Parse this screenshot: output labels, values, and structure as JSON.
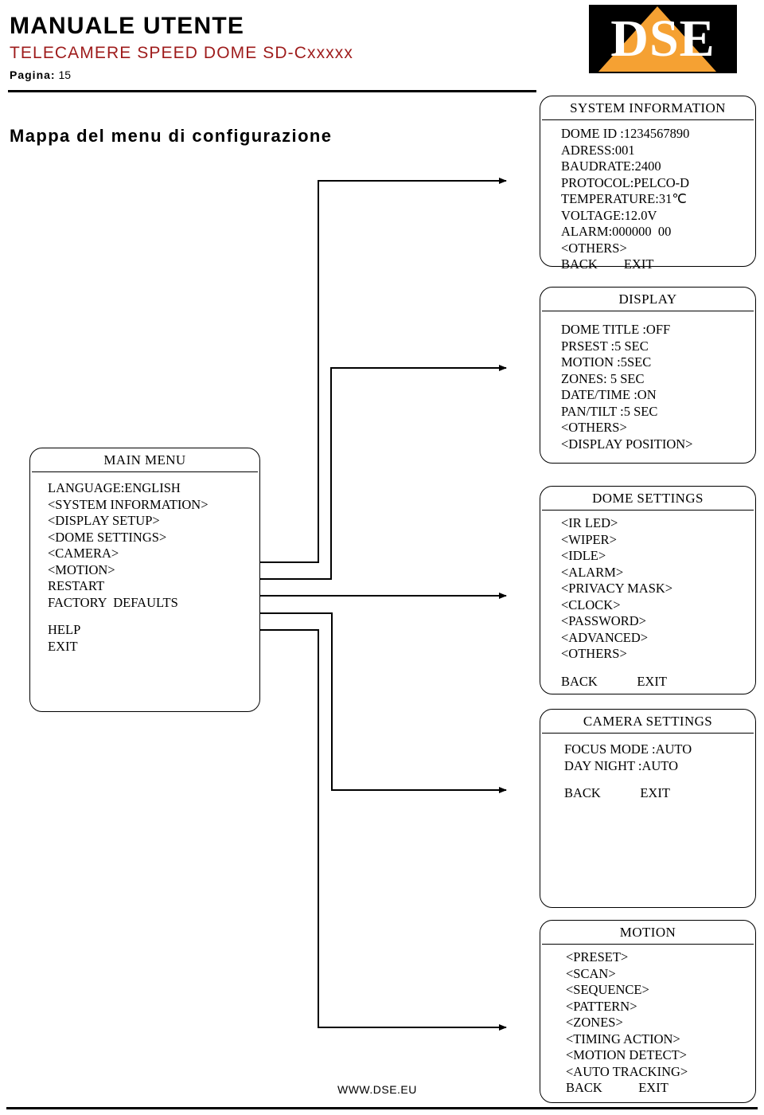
{
  "header": {
    "title": "MANUALE UTENTE",
    "subtitle": "TELECAMERE SPEED DOME SD-Cxxxxx",
    "page_label": "Pagina:",
    "page_number": "15",
    "logo_text": "DSE",
    "logo_bg": "#000000",
    "logo_accent": "#F5A133",
    "subtitle_color": "#9E1B1B"
  },
  "section": {
    "title": "Mappa del menu di configurazione"
  },
  "boxes": {
    "system_information": {
      "title": "SYSTEM INFORMATION",
      "rows": [
        "DOME ID :1234567890",
        "ADRESS:001",
        "BAUDRATE:2400",
        "PROTOCOL:PELCO-D",
        "TEMPERATURE:31℃",
        "VOLTAGE:12.0V",
        "ALARM:000000  00",
        "<OTHERS>"
      ],
      "nav": "BACK        EXIT"
    },
    "display": {
      "title": "DISPLAY",
      "rows": [
        "DOME TITLE :OFF",
        "PRSEST :5 SEC",
        "MOTION :5SEC",
        "ZONES: 5 SEC",
        "DATE/TIME :ON",
        "PAN/TILT :5 SEC",
        "<OTHERS>",
        "<DISPLAY POSITION>"
      ],
      "nav": ""
    },
    "main_menu": {
      "title": "MAIN MENU",
      "rows": [
        "LANGUAGE:ENGLISH",
        "<SYSTEM INFORMATION>",
        "<DISPLAY SETUP>",
        "<DOME SETTINGS>",
        "<CAMERA>",
        "<MOTION>",
        "RESTART",
        "FACTORY  DEFAULTS"
      ],
      "nav_1": "HELP",
      "nav_2": "EXIT"
    },
    "dome_settings": {
      "title": "DOME SETTINGS",
      "rows": [
        "<IR LED>",
        "<WIPER>",
        "<IDLE>",
        "<ALARM>",
        "<PRIVACY MASK>",
        "<CLOCK>",
        "<PASSWORD>",
        "<ADVANCED>",
        "<OTHERS>"
      ],
      "nav": "BACK            EXIT"
    },
    "camera_settings": {
      "title": "CAMERA SETTINGS",
      "rows": [
        "FOCUS MODE :AUTO",
        "DAY NIGHT :AUTO"
      ],
      "nav": "BACK            EXIT"
    },
    "motion": {
      "title": "MOTION",
      "rows": [
        "<PRESET>",
        "<SCAN>",
        "<SEQUENCE>",
        "<PATTERN>",
        "<ZONES>",
        "<TIMING ACTION>",
        "<MOTION DETECT>",
        "<AUTO TRACKING>"
      ],
      "nav": "BACK           EXIT"
    }
  },
  "footer": {
    "url": "WWW.DSE.EU"
  }
}
